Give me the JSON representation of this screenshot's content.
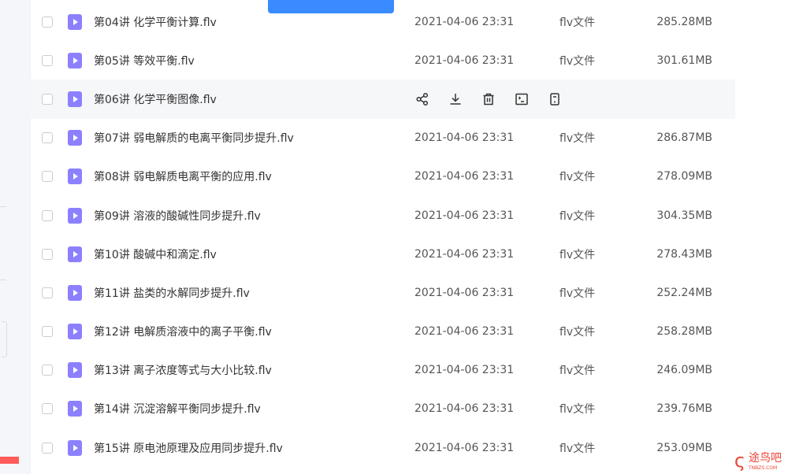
{
  "top_button_label": "",
  "files": [
    {
      "name": "第04讲 化学平衡计算.flv",
      "date": "2021-04-06 23:31",
      "type": "flv文件",
      "size": "285.28MB"
    },
    {
      "name": "第05讲 等效平衡.flv",
      "date": "2021-04-06 23:31",
      "type": "flv文件",
      "size": "301.61MB"
    },
    {
      "name": "第06讲 化学平衡图像.flv",
      "date": "",
      "type": "",
      "size": ""
    },
    {
      "name": "第07讲 弱电解质的电离平衡同步提升.flv",
      "date": "2021-04-06 23:31",
      "type": "flv文件",
      "size": "286.87MB"
    },
    {
      "name": "第08讲 弱电解质电离平衡的应用.flv",
      "date": "2021-04-06 23:31",
      "type": "flv文件",
      "size": "278.09MB"
    },
    {
      "name": "第09讲 溶液的酸碱性同步提升.flv",
      "date": "2021-04-06 23:31",
      "type": "flv文件",
      "size": "304.35MB"
    },
    {
      "name": "第10讲 酸碱中和滴定.flv",
      "date": "2021-04-06 23:31",
      "type": "flv文件",
      "size": "278.43MB"
    },
    {
      "name": "第11讲 盐类的水解同步提升.flv",
      "date": "2021-04-06 23:31",
      "type": "flv文件",
      "size": "252.24MB"
    },
    {
      "name": "第12讲 电解质溶液中的离子平衡.flv",
      "date": "2021-04-06 23:31",
      "type": "flv文件",
      "size": "258.28MB"
    },
    {
      "name": "第13讲 离子浓度等式与大小比较.flv",
      "date": "2021-04-06 23:31",
      "type": "flv文件",
      "size": "246.09MB"
    },
    {
      "name": "第14讲 沉淀溶解平衡同步提升.flv",
      "date": "2021-04-06 23:31",
      "type": "flv文件",
      "size": "239.76MB"
    },
    {
      "name": "第15讲 原电池原理及应用同步提升.flv",
      "date": "2021-04-06 23:31",
      "type": "flv文件",
      "size": "253.09MB"
    }
  ],
  "hover_row_index": 2,
  "hover_actions": [
    "share-icon",
    "download-icon",
    "delete-icon",
    "rename-icon",
    "more-icon"
  ],
  "watermark": {
    "text": "途鸟吧",
    "sub": "TNBZS.COM"
  },
  "colors": {
    "accent": "#3a8bff",
    "file_icon": "#8c80ff",
    "hover_row": "#f6f7f9",
    "watermark": "#e8473a"
  }
}
